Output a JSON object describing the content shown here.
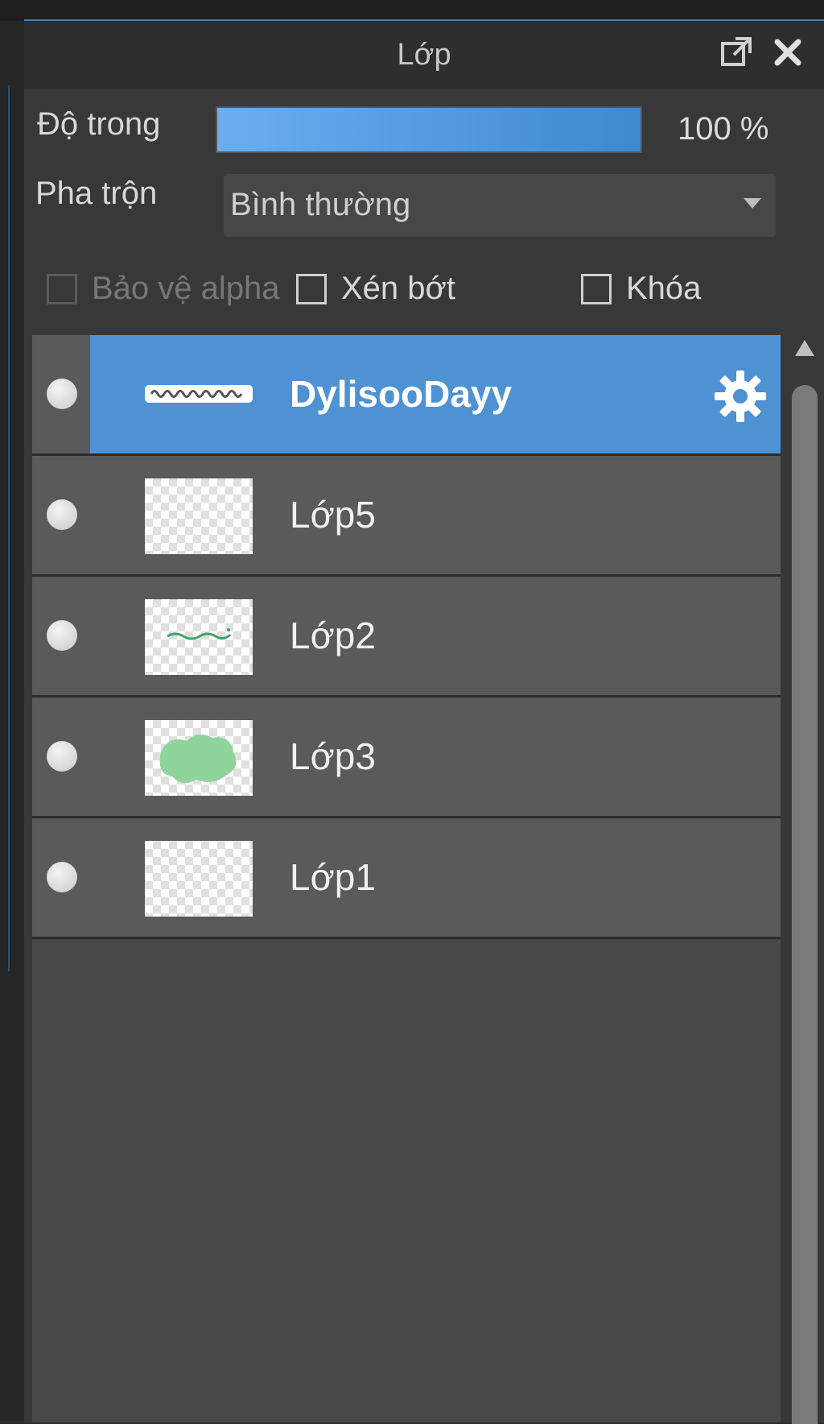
{
  "panel": {
    "title": "Lớp",
    "opacity_label": "Độ trong",
    "opacity_value": 100,
    "opacity_text": "100 %",
    "blend_label": "Pha trộn",
    "blend_value": "Bình thường",
    "checkboxes": [
      {
        "label": "Bảo vệ alpha",
        "checked": false,
        "enabled": false
      },
      {
        "label": "Xén bớt",
        "checked": false,
        "enabled": true
      },
      {
        "label": "Khóa",
        "checked": false,
        "enabled": true
      }
    ]
  },
  "layers": [
    {
      "name": "DylisooDayy",
      "selected": true,
      "visible": true
    },
    {
      "name": "Lớp5",
      "selected": false,
      "visible": true
    },
    {
      "name": "Lớp2",
      "selected": false,
      "visible": true
    },
    {
      "name": "Lớp3",
      "selected": false,
      "visible": true
    },
    {
      "name": "Lớp1",
      "selected": false,
      "visible": true
    }
  ],
  "colors": {
    "accent": "#4e92d3",
    "panel": "#383838",
    "layer_bg": "#5a5a5a"
  },
  "icons": [
    "popout-icon",
    "close-icon",
    "chevron-down-icon",
    "visibility-dot-icon",
    "gear-icon",
    "scroll-up-icon"
  ]
}
